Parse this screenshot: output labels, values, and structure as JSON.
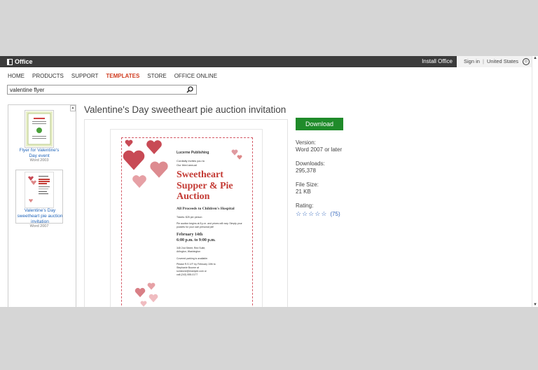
{
  "topbar": {
    "logo_text": "Office",
    "install": "Install Office",
    "sign_in": "Sign in",
    "separator": "|",
    "country": "United States"
  },
  "nav": [
    "HOME",
    "PRODUCTS",
    "SUPPORT",
    "TEMPLATES",
    "STORE",
    "OFFICE ONLINE"
  ],
  "nav_active": "TEMPLATES",
  "search": {
    "value": "valentine flyer",
    "placeholder": ""
  },
  "sidebar": {
    "items": [
      {
        "label": "Flyer for Valentine's Day event",
        "version": "Word 2003"
      },
      {
        "label": "Valentine's Day sweetheart pie auction invitation",
        "version": "Word 2007"
      }
    ]
  },
  "template": {
    "title": "Valentine's Day sweetheart pie auction invitation",
    "preview": {
      "publisher": "Lucerne Publishing",
      "intro_line1": "Cordially invites you to",
      "intro_line2": "Our third annual",
      "headline1": "Sweetheart",
      "headline2": "Supper & Pie",
      "headline3": "Auction",
      "proceeds": "All Proceeds to Children's Hospital",
      "tickets": "Tickets: $25 per person",
      "auction_note1": "Pie auction begins at 8 p.m. and prices will vary. Simply your",
      "auction_note2": "pockets for your own personal pie!",
      "date": "February 14th",
      "time": "6:00 p.m. to 9:00 p.m.",
      "address1": "345 2nd Street, Red Suite,",
      "address2": "Arlington, Washington",
      "parking": "Covered parking is available.",
      "rsvp1": "Please R.S.V.P. by February 10th to",
      "rsvp2": "Stephanie Bourne at",
      "rsvp3": "someone@example.com or",
      "rsvp4": "call (243) 555-0177"
    },
    "download_label": "Download",
    "version_label": "Version:",
    "version_value": "Word 2007 or later",
    "downloads_label": "Downloads:",
    "downloads_value": "295,378",
    "filesize_label": "File Size:",
    "filesize_value": "21 KB",
    "rating_label": "Rating:",
    "rating_stars": 4,
    "rating_count": "(75)"
  },
  "colors": {
    "accent": "#d03c20",
    "download": "#1f8b2a",
    "link": "#2266bb",
    "heart": "#c84a55"
  }
}
